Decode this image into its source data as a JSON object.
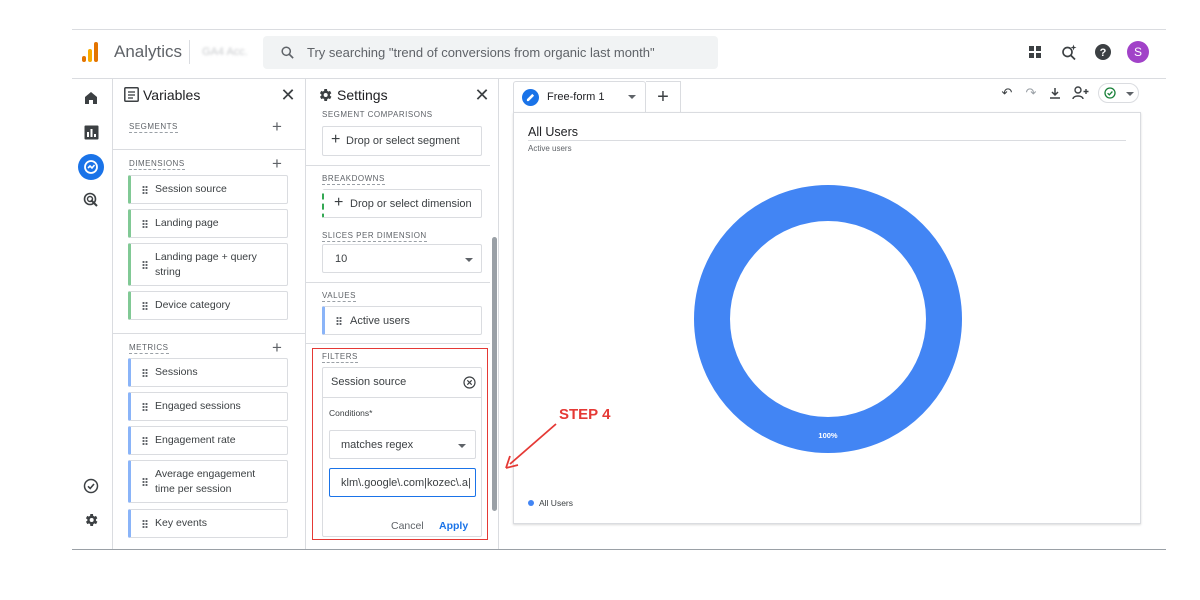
{
  "header": {
    "app_name": "Analytics",
    "account_name": "GA4 Acc.",
    "search_placeholder": "Try searching \"trend of conversions from organic last month\"",
    "avatar_initial": "S"
  },
  "colors": {
    "accent": "#1a73e8",
    "donut": "#4285f4",
    "annotation_red": "#e53935",
    "avatar": "#a142c8",
    "dimension_chip": "#81c995",
    "metric_chip": "#8ab4f8"
  },
  "variables_panel": {
    "title": "Variables",
    "segments_label": "SEGMENTS",
    "dimensions_label": "DIMENSIONS",
    "dimensions": [
      "Session source",
      "Landing page",
      "Landing page + query string",
      "Device category"
    ],
    "metrics_label": "METRICS",
    "metrics": [
      "Sessions",
      "Engaged sessions",
      "Engagement rate",
      "Average engagement time per session",
      "Key events"
    ]
  },
  "settings_panel": {
    "title": "Settings",
    "segment_comparisons_label": "SEGMENT COMPARISONS",
    "segment_placeholder": "Drop or select segment",
    "breakdowns_label": "BREAKDOWNS",
    "dimension_placeholder": "Drop or select dimension",
    "slices_label": "SLICES PER DIMENSION",
    "slices_value": "10",
    "values_label": "VALUES",
    "value_item": "Active users",
    "filters_label": "FILTERS",
    "filter": {
      "dimension": "Session source",
      "conditions_label": "Conditions*",
      "match_type": "matches regex",
      "expression": "klm\\.google\\.com|kozec\\.a|",
      "cancel_label": "Cancel",
      "apply_label": "Apply"
    }
  },
  "tab": {
    "label": "Free-form 1"
  },
  "chart_data": {
    "type": "pie",
    "title": "All Users",
    "subtitle": "Active users",
    "series": [
      {
        "name": "All Users",
        "values": [
          100
        ]
      }
    ],
    "slice_labels": [
      "100%"
    ],
    "legend": [
      "All Users"
    ],
    "legend_position": "bottom-left"
  },
  "annotation": {
    "label": "STEP 4"
  }
}
